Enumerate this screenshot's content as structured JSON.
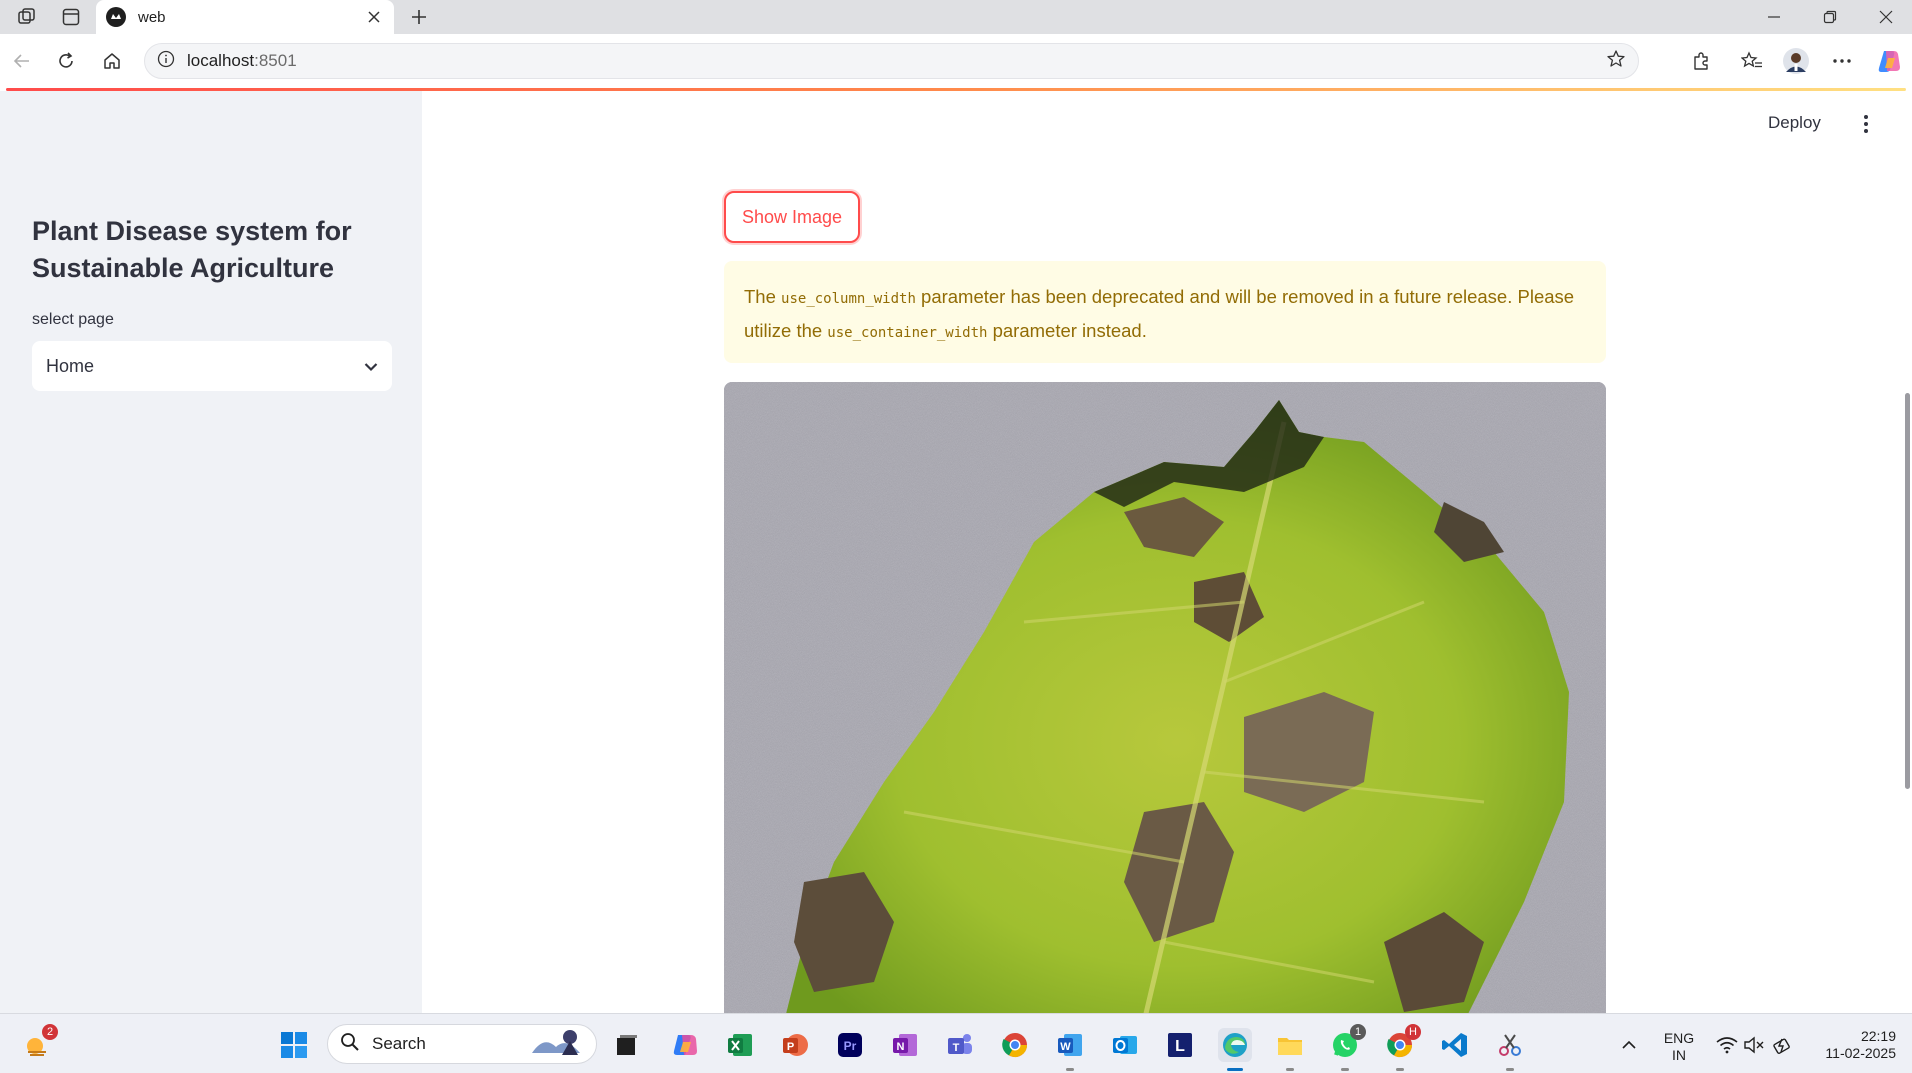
{
  "browser": {
    "tab_title": "web",
    "url_host": "localhost",
    "url_port": ":8501"
  },
  "sidebar": {
    "title": "Plant Disease system for Sustainable Agriculture",
    "select_label": "select page",
    "select_value": "Home"
  },
  "header": {
    "deploy_label": "Deploy"
  },
  "main": {
    "button_label": "Show Image",
    "warning": {
      "part1": "The ",
      "code1": "use_column_width",
      "part2": " parameter has been deprecated and will be removed in a future release. Please utilize the ",
      "code2": "use_container_width",
      "part3": " parameter instead."
    }
  },
  "taskbar": {
    "search_label": "Search",
    "weather_badge": "2",
    "whatsapp_badge": "1",
    "chrome_badge": "H",
    "lang_top": "ENG",
    "lang_bottom": "IN",
    "time": "22:19",
    "date": "11-02-2025"
  },
  "colors": {
    "accent": "#ff4b4b",
    "warning_bg": "#fffce5",
    "warning_text": "#926c05",
    "sidebar_bg": "#f0f2f6"
  }
}
